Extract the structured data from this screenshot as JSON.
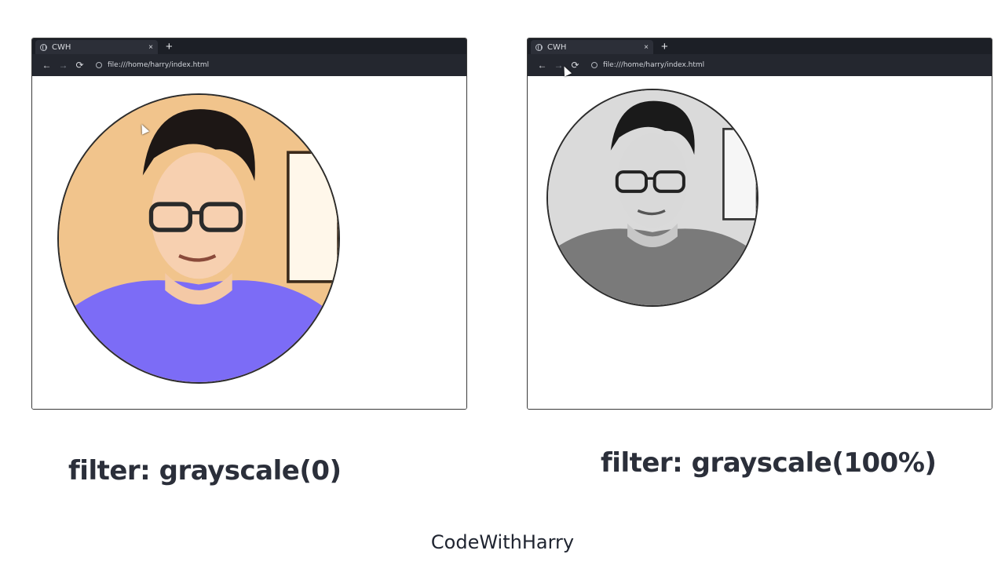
{
  "windows": [
    {
      "tab_title": "CWH",
      "tab_close": "×",
      "new_tab": "+",
      "nav": {
        "back": "←",
        "forward": "→",
        "reload": "⟳"
      },
      "url": "file:///home/harry/index.html",
      "image_filter": "grayscale(0)"
    },
    {
      "tab_title": "CWH",
      "tab_close": "×",
      "new_tab": "+",
      "nav": {
        "back": "←",
        "forward": "→",
        "reload": "⟳"
      },
      "url": "file:///home/harry/index.html",
      "image_filter": "grayscale(100%)"
    }
  ],
  "captions": {
    "left": "filter: grayscale(0)",
    "right": "filter: grayscale(100%)"
  },
  "brand": "CodeWithHarry",
  "colors": {
    "chrome_dark": "#1c1f26",
    "navbar": "#24272f",
    "caption_text": "#2b2f3a",
    "shirt": "#7c6cf6"
  },
  "icons": [
    "globe-icon",
    "close-icon",
    "plus-icon",
    "back-arrow-icon",
    "forward-arrow-icon",
    "reload-icon",
    "cursor-icon"
  ]
}
